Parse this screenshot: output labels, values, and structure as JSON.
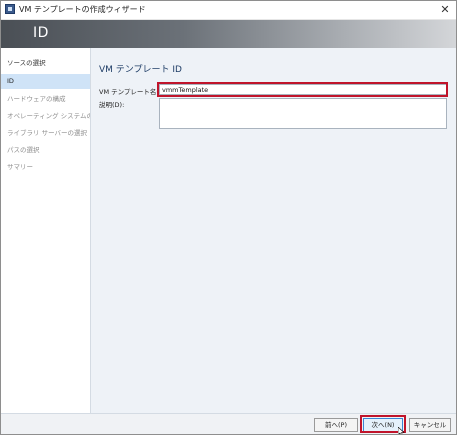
{
  "window": {
    "title": "VM テンプレートの作成ウィザード",
    "close_glyph": "✕"
  },
  "banner": {
    "title": "ID"
  },
  "sidebar": {
    "items": [
      {
        "label": "ソースの選択",
        "state": "done"
      },
      {
        "label": "ID",
        "state": "active"
      },
      {
        "label": "ハードウェアの構成",
        "state": "pending"
      },
      {
        "label": "オペレーティング システムの構成",
        "state": "pending"
      },
      {
        "label": "ライブラリ サーバーの選択",
        "state": "pending"
      },
      {
        "label": "パスの選択",
        "state": "pending"
      },
      {
        "label": "サマリー",
        "state": "pending"
      }
    ]
  },
  "main": {
    "section_title": "VM テンプレート ID",
    "name_label": "VM テンプレート名(T):",
    "name_value": "vmmTemplate",
    "description_label": "説明(D):",
    "description_value": ""
  },
  "footer": {
    "back_label": "前へ(P)",
    "next_label": "次へ(N)",
    "cancel_label": "キャンセル"
  },
  "colors": {
    "highlight": "#c0142b",
    "active_nav": "#cfe3f7",
    "content_bg": "#eef2f7",
    "section_title": "#1f3d66"
  },
  "icons": {
    "app": "vm-template-wizard-icon",
    "close": "close-icon",
    "cursor": "mouse-pointer-icon"
  }
}
